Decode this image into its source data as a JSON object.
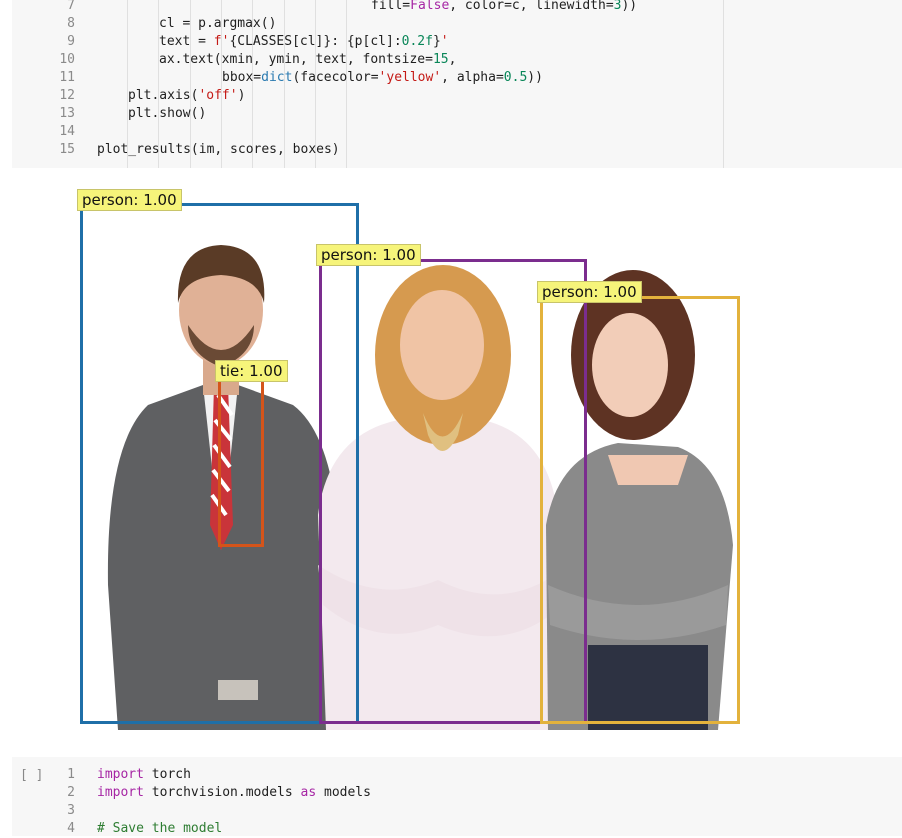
{
  "cell1": {
    "lines": [
      {
        "n": "7",
        "html": "<span style=\"padding-left:274px\"></span>fill=<span class=\"kw\">False</span>, color=c, linewidth=<span class=\"num\">3</span>))"
      },
      {
        "n": "8",
        "html": "<span style=\"padding-left:62px\"></span>cl = p.argmax()"
      },
      {
        "n": "9",
        "html": "<span style=\"padding-left:62px\"></span>text = <span class=\"str\">f'</span>{CLASSES[cl]}: {p[cl]:<span class=\"num\">0.2f</span>}<span class=\"str\">'</span>"
      },
      {
        "n": "10",
        "html": "<span style=\"padding-left:62px\"></span>ax.text(xmin, ymin, text, fontsize=<span class=\"num\">15</span>,"
      },
      {
        "n": "11",
        "html": "<span style=\"padding-left:125px\"></span>bbox=<span class=\"fn\">dict</span>(facecolor=<span class=\"str\">'yellow'</span>, alpha=<span class=\"num\">0.5</span>))"
      },
      {
        "n": "12",
        "html": "<span style=\"padding-left:31px\"></span>plt.axis(<span class=\"str\">'off'</span>)"
      },
      {
        "n": "13",
        "html": "<span style=\"padding-left:31px\"></span>plt.show()"
      },
      {
        "n": "14",
        "html": ""
      },
      {
        "n": "15",
        "html": "plot_results(im, scores, boxes)"
      }
    ]
  },
  "output": {
    "detections": [
      {
        "label": "person: 1.00",
        "color": "#1f6fa8"
      },
      {
        "label": "person: 1.00",
        "color": "#7b2d8e"
      },
      {
        "label": "person: 1.00",
        "color": "#e3b23c"
      },
      {
        "label": "tie: 1.00",
        "color": "#d4541a"
      }
    ]
  },
  "cell2": {
    "bracket": "[ ]",
    "lines": [
      {
        "n": "1",
        "html": "<span class=\"kw\">import</span> torch"
      },
      {
        "n": "2",
        "html": "<span class=\"kw\">import</span> torchvision.models <span class=\"kw\">as</span> models"
      },
      {
        "n": "3",
        "html": ""
      },
      {
        "n": "4",
        "html": "<span class=\"cmt\"># Save the model</span>"
      }
    ]
  }
}
